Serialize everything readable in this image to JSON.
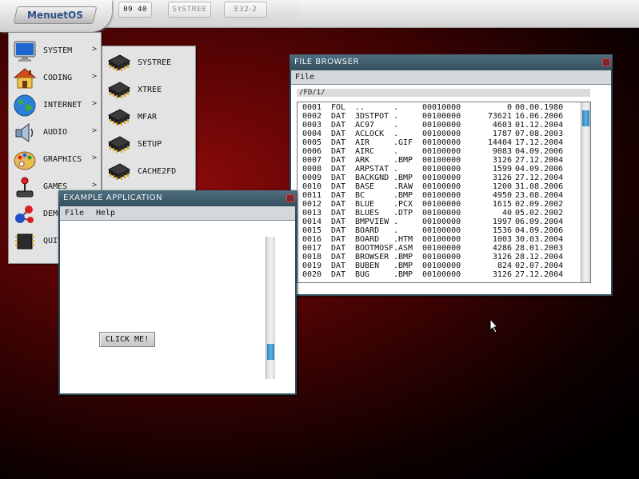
{
  "taskbar": {
    "logo_text": "MenuetOS",
    "clock": "09 40",
    "buttons": [
      "SYSTREE",
      "E32-2"
    ]
  },
  "main_menu": {
    "items": [
      {
        "label": "SYSTEM",
        "icon": "monitor-icon"
      },
      {
        "label": "CODING",
        "icon": "house-icon"
      },
      {
        "label": "INTERNET",
        "icon": "globe-icon"
      },
      {
        "label": "AUDIO",
        "icon": "speaker-icon"
      },
      {
        "label": "GRAPHICS",
        "icon": "palette-icon"
      },
      {
        "label": "GAMES",
        "icon": "joystick-icon"
      },
      {
        "label": "DEMOS",
        "icon": "molecule-icon"
      },
      {
        "label": "QUIT",
        "icon": "chip-icon"
      }
    ],
    "arrow": ">"
  },
  "submenu": {
    "items": [
      {
        "label": "SYSTREE",
        "icon": "chip-icon"
      },
      {
        "label": "XTREE",
        "icon": "chip-icon"
      },
      {
        "label": "MFAR",
        "icon": "chip-icon"
      },
      {
        "label": "SETUP",
        "icon": "chip-icon"
      },
      {
        "label": "CACHE2FD",
        "icon": "chip-icon"
      }
    ]
  },
  "example_app": {
    "title": "EXAMPLE APPLICATION",
    "menu": [
      "File",
      "Help"
    ],
    "button_label": "CLICK ME!",
    "scrollbar_position": 0.85
  },
  "file_browser": {
    "title": "FILE BROWSER",
    "menu": [
      "File"
    ],
    "path": "/FD/1/",
    "scrollbar_position": 0.05,
    "rows": [
      [
        "0001",
        "FOL",
        "..",
        ".",
        "00010000",
        "0",
        "00.00.1980"
      ],
      [
        "0002",
        "DAT",
        "3DSTPOT",
        ".",
        "00100000",
        "73621",
        "16.06.2006"
      ],
      [
        "0003",
        "DAT",
        "AC97",
        ".",
        "00100000",
        "4603",
        "01.12.2004"
      ],
      [
        "0004",
        "DAT",
        "ACLOCK",
        ".",
        "00100000",
        "1787",
        "07.08.2003"
      ],
      [
        "0005",
        "DAT",
        "AIR",
        ".GIF",
        "00100000",
        "14404",
        "17.12.2004"
      ],
      [
        "0006",
        "DAT",
        "AIRC",
        ".",
        "00100000",
        "9083",
        "04.09.2006"
      ],
      [
        "0007",
        "DAT",
        "ARK",
        ".BMP",
        "00100000",
        "3126",
        "27.12.2004"
      ],
      [
        "0008",
        "DAT",
        "ARPSTAT",
        ".",
        "00100000",
        "1599",
        "04.09.2006"
      ],
      [
        "0009",
        "DAT",
        "BACKGND",
        ".BMP",
        "00100000",
        "3126",
        "27.12.2004"
      ],
      [
        "0010",
        "DAT",
        "BASE",
        ".RAW",
        "00100000",
        "1200",
        "31.08.2006"
      ],
      [
        "0011",
        "DAT",
        "BC",
        ".BMP",
        "00100000",
        "4950",
        "23.08.2004"
      ],
      [
        "0012",
        "DAT",
        "BLUE",
        ".PCX",
        "00100000",
        "1615",
        "02.09.2002"
      ],
      [
        "0013",
        "DAT",
        "BLUES",
        ".DTP",
        "00100000",
        "40",
        "05.02.2002"
      ],
      [
        "0014",
        "DAT",
        "BMPVIEW",
        ".",
        "00100000",
        "1997",
        "06.09.2004"
      ],
      [
        "0015",
        "DAT",
        "BOARD",
        ".",
        "00100000",
        "1536",
        "04.09.2006"
      ],
      [
        "0016",
        "DAT",
        "BOARD",
        ".HTM",
        "00100000",
        "1003",
        "30.03.2004"
      ],
      [
        "0017",
        "DAT",
        "BOOTMOSF",
        ".ASM",
        "00100000",
        "4286",
        "28.01.2003"
      ],
      [
        "0018",
        "DAT",
        "BROWSER",
        ".BMP",
        "00100000",
        "3126",
        "28.12.2004"
      ],
      [
        "0019",
        "DAT",
        "BUBEN",
        ".BMP",
        "00100000",
        "824",
        "02.07.2004"
      ],
      [
        "0020",
        "DAT",
        "BUG",
        ".BMP",
        "00100000",
        "3126",
        "27.12.2004"
      ]
    ]
  },
  "colors": {
    "window_frame": "#2e4b5c",
    "title_text": "#eef4f7",
    "scroll_thumb": "#3b8fcc",
    "desktop": "#5c0404"
  }
}
